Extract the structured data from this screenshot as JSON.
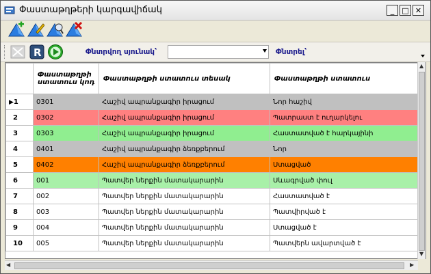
{
  "window": {
    "title": "Փաստաթղթերի կարգավիճակ"
  },
  "window_controls": {
    "minimize": "_",
    "maximize": "□",
    "close": "✕"
  },
  "toolbar_icons": [
    "add-icon",
    "edit-icon",
    "view-icon",
    "delete-icon"
  ],
  "filter_bar": {
    "icons": [
      "disabled-mail-icon",
      "refresh-icon",
      "run-icon"
    ],
    "column_label": "Փնտրվող սյունակ՝",
    "column_value": "",
    "search_label": "Փնտրել՝"
  },
  "grid": {
    "columns": [
      "Փաստաթղթի ստատուս կոդ",
      "Փաստաթղթի ստատուս տեսակ",
      "Փաստաթղթի ստատուս"
    ],
    "selected_marker": "▶",
    "rows": [
      {
        "num": "1",
        "code": "0301",
        "type": "Հաշիվ ապրանքագիր իրացում",
        "status": "Նոր հաշիվ",
        "color": "#c0c0c0"
      },
      {
        "num": "2",
        "code": "0302",
        "type": "Հաշիվ ապրանքագիր իրացում",
        "status": "Պատրաստ է ուղարկելու",
        "color": "#ff8080"
      },
      {
        "num": "3",
        "code": "0303",
        "type": "Հաշիվ ապրանքագիր իրացում",
        "status": "Հաստատված է հարկայինի",
        "color": "#90ee90"
      },
      {
        "num": "4",
        "code": "0401",
        "type": "Հաշիվ ապրանքագիր ձեռքբերում",
        "status": "Նոր",
        "color": "#c0c0c0"
      },
      {
        "num": "5",
        "code": "0402",
        "type": "Հաշիվ ապրանքագիր ձեռքբերում",
        "status": "Ստացված",
        "color": "#ff8000"
      },
      {
        "num": "6",
        "code": "001",
        "type": "Պատվեր ներքին մատակարարին",
        "status": "Սևագրված փուլ",
        "color": "#a8f0a8"
      },
      {
        "num": "7",
        "code": "002",
        "type": "Պատվեր ներքին մատակարարին",
        "status": "Հաստատված է",
        "color": "#ffffff"
      },
      {
        "num": "8",
        "code": "003",
        "type": "Պատվեր ներքին մատակարարին",
        "status": "Պատվիրված է",
        "color": "#ffffff"
      },
      {
        "num": "9",
        "code": "004",
        "type": "Պատվեր ներքին մատակարարին",
        "status": "Ստացված է",
        "color": "#ffffff"
      },
      {
        "num": "10",
        "code": "005",
        "type": "Պատվեր ներքին մատակարարին",
        "status": "Պատվերն ավարտված է",
        "color": "#ffffff"
      }
    ]
  }
}
